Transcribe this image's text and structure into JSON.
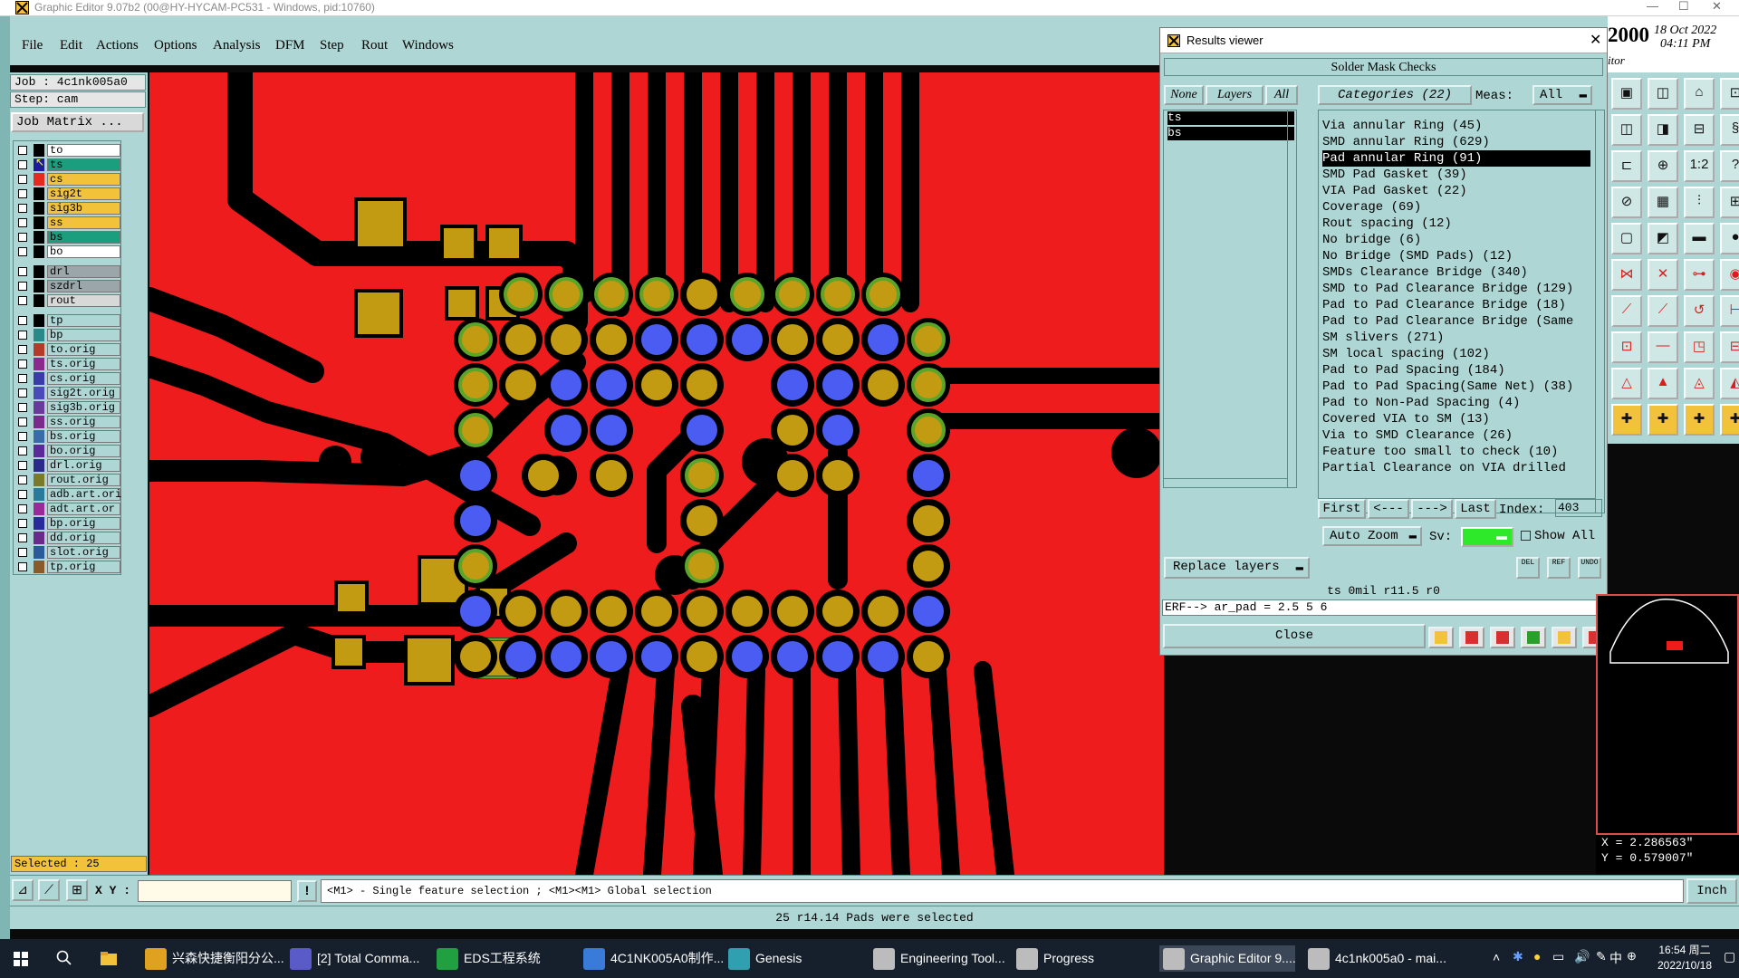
{
  "window": {
    "title": "Graphic Editor 9.07b2 (00@HY-HYCAM-PC531 - Windows, pid:10760)"
  },
  "menu": [
    "File",
    "Edit",
    "Actions",
    "Options",
    "Analysis",
    "DFM",
    "Step",
    "Rout",
    "Windows"
  ],
  "job": {
    "job": "Job : 4c1nk005a0",
    "step": "Step: cam",
    "matrix": "Job Matrix ..."
  },
  "layers": [
    {
      "name": "to",
      "color": "#ffffff",
      "sw": "#000000"
    },
    {
      "name": "ts",
      "color": "#1a9e7e",
      "sw": "#1c1c9a",
      "active": true
    },
    {
      "name": "cs",
      "color": "#f2c33a",
      "sw": "#e62a20"
    },
    {
      "name": "sig2t",
      "color": "#f2c33a",
      "sw": "#000000"
    },
    {
      "name": "sig3b",
      "color": "#f2c33a",
      "sw": "#000000"
    },
    {
      "name": "ss",
      "color": "#f2c33a",
      "sw": "#000000"
    },
    {
      "name": "bs",
      "color": "#1a9e7e",
      "sw": "#000000"
    },
    {
      "name": "bo",
      "color": "#ffffff",
      "sw": "#000000"
    },
    {
      "name": "drl",
      "color": "#9aa6aa",
      "sw": "#000000",
      "gap": true
    },
    {
      "name": "szdrl",
      "color": "#9aa6aa",
      "sw": "#000000"
    },
    {
      "name": "rout",
      "color": "#d8d8d8",
      "sw": "#000000"
    },
    {
      "name": "tp",
      "color": "#aed6d4",
      "sw": "#000000",
      "gap": true
    },
    {
      "name": "bp",
      "color": "#aed6d4",
      "sw": "#2a8a8a"
    },
    {
      "name": "to.orig",
      "color": "#aed6d4",
      "sw": "#b43a2a"
    },
    {
      "name": "ts.orig",
      "color": "#aed6d4",
      "sw": "#8a2a8a"
    },
    {
      "name": "cs.orig",
      "color": "#aed6d4",
      "sw": "#3a3aa8"
    },
    {
      "name": "sig2t.orig",
      "color": "#aed6d4",
      "sw": "#4a4ab8"
    },
    {
      "name": "sig3b.orig",
      "color": "#aed6d4",
      "sw": "#6a3a9a"
    },
    {
      "name": "ss.orig",
      "color": "#aed6d4",
      "sw": "#7a2a8a"
    },
    {
      "name": "bs.orig",
      "color": "#aed6d4",
      "sw": "#3a6aa8"
    },
    {
      "name": "bo.orig",
      "color": "#aed6d4",
      "sw": "#5a2a9a"
    },
    {
      "name": "drl.orig",
      "color": "#aed6d4",
      "sw": "#2a2a8a"
    },
    {
      "name": "rout.orig",
      "color": "#aed6d4",
      "sw": "#7a7a2a"
    },
    {
      "name": "adb.art.ori",
      "color": "#aed6d4",
      "sw": "#2a7a9a"
    },
    {
      "name": "adt.art.or",
      "color": "#aed6d4",
      "sw": "#9a2a9a"
    },
    {
      "name": "bp.orig",
      "color": "#aed6d4",
      "sw": "#2a2a9a"
    },
    {
      "name": "dd.orig",
      "color": "#aed6d4",
      "sw": "#6a2a8a"
    },
    {
      "name": "slot.orig",
      "color": "#aed6d4",
      "sw": "#2a5a9a"
    },
    {
      "name": "tp.orig",
      "color": "#aed6d4",
      "sw": "#8a5a2a"
    }
  ],
  "selected": "Selected : 25",
  "canvas": {
    "board_color": "#ee1c1c",
    "pad_color": "#c29b12",
    "blue_pad": "#4a5cf2",
    "green_ring": "#5aa52a"
  },
  "results": {
    "title": "Results viewer",
    "header": "Solder Mask Checks",
    "none": "None",
    "layers_btn": "Layers",
    "all": "All",
    "categories": "Categories (22)",
    "meas": "Meas:",
    "meas_val": "All",
    "layer_items": [
      "ts",
      "bs"
    ],
    "items": [
      "Via annular Ring (45)",
      "SMD annular Ring (629)",
      "Pad annular Ring (91)",
      "SMD Pad Gasket (39)",
      "VIA Pad Gasket (22)",
      "Coverage (69)",
      "Rout spacing (12)",
      "No bridge (6)",
      "No Bridge (SMD Pads) (12)",
      "SMDs Clearance Bridge (340)",
      "SMD to Pad Clearance Bridge (129)",
      "Pad to Pad Clearance Bridge (18)",
      "Pad to Pad Clearance Bridge (Same",
      "SM slivers (271)",
      "SM local spacing (102)",
      "Pad to Pad Spacing (184)",
      "Pad to Pad Spacing(Same Net) (38)",
      "Pad to Non-Pad Spacing (4)",
      "Covered VIA to SM (13)",
      "Via to SMD Clearance (26)",
      "Feature too small to check (10)",
      "Partial Clearance on VIA drilled"
    ],
    "selected_index": 2,
    "nav": {
      "first": "First",
      "prev": "<---",
      "next": "--->",
      "last": "Last",
      "index_label": "Index:",
      "index": "403"
    },
    "autozoom": "Auto Zoom",
    "sv": "Sv:",
    "show_all": "Show All",
    "replace": "Replace layers",
    "small_btns": [
      "DEL",
      "REF",
      "UNDO"
    ],
    "info": "ts 0mil  r11.5  r0",
    "erf": "ERF--> ar_pad = 2.5 5 6",
    "close": "Close"
  },
  "topright": {
    "year": "2000",
    "date": "18 Oct 2022",
    "time": "04:11 PM",
    "sub": "itor"
  },
  "coords": {
    "x": "X = 2.286563\"",
    "y": "Y = 0.579007\""
  },
  "status": {
    "xy_label": "X Y :",
    "hint": "<M1> - Single feature selection ; <M1><M1> Global selection",
    "units": "Inch",
    "message": "25 r14.14 Pads were selected"
  },
  "taskbar": {
    "tasks": [
      {
        "label": "兴森快捷衡阳分公...",
        "color": "#e0a020"
      },
      {
        "label": "[2] Total Comma...",
        "color": "#5a5ac8"
      },
      {
        "label": "EDS工程系统",
        "color": "#20a040"
      },
      {
        "label": "4C1NK005A0制作...",
        "color": "#3a7ad8"
      },
      {
        "label": "Genesis",
        "color": "#30a0b0"
      },
      {
        "label": "Engineering Tool...",
        "color": "#bcbcbc"
      },
      {
        "label": "Progress",
        "color": "#bcbcbc"
      },
      {
        "label": "Graphic Editor 9....",
        "color": "#bcbcbc",
        "active": true
      },
      {
        "label": "4c1nk005a0 - mai...",
        "color": "#bcbcbc"
      }
    ],
    "time": "16:54 周二",
    "date": "2022/10/18",
    "ime": "中"
  }
}
